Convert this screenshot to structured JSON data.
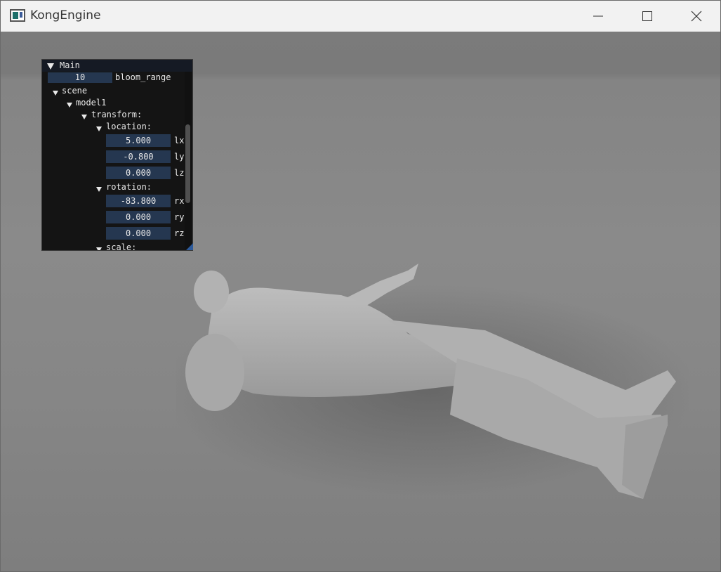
{
  "window": {
    "title": "KongEngine"
  },
  "panel": {
    "title": "Main",
    "bloom": {
      "value": "10",
      "label": "bloom_range"
    },
    "tree": {
      "scene": "scene",
      "model": "model1",
      "transform": "transform:",
      "location": "location:",
      "rotation": "rotation:",
      "scale": "scale:"
    },
    "location": [
      {
        "value": "5.000",
        "label": "lx"
      },
      {
        "value": "-0.800",
        "label": "ly"
      },
      {
        "value": "0.000",
        "label": "lz"
      }
    ],
    "rotation": [
      {
        "value": "-83.800",
        "label": "rx"
      },
      {
        "value": "0.000",
        "label": "ry"
      },
      {
        "value": "0.000",
        "label": "rz"
      }
    ]
  },
  "colors": {
    "field_bg": "#253750",
    "panel_bg": "#141414",
    "accent": "#2d5a9a",
    "viewport": "#8a8a8a"
  },
  "icons": {
    "app": "app-icon",
    "minimize": "minimize-icon",
    "maximize": "maximize-icon",
    "close": "close-icon",
    "collapse": "triangle-down-icon"
  }
}
